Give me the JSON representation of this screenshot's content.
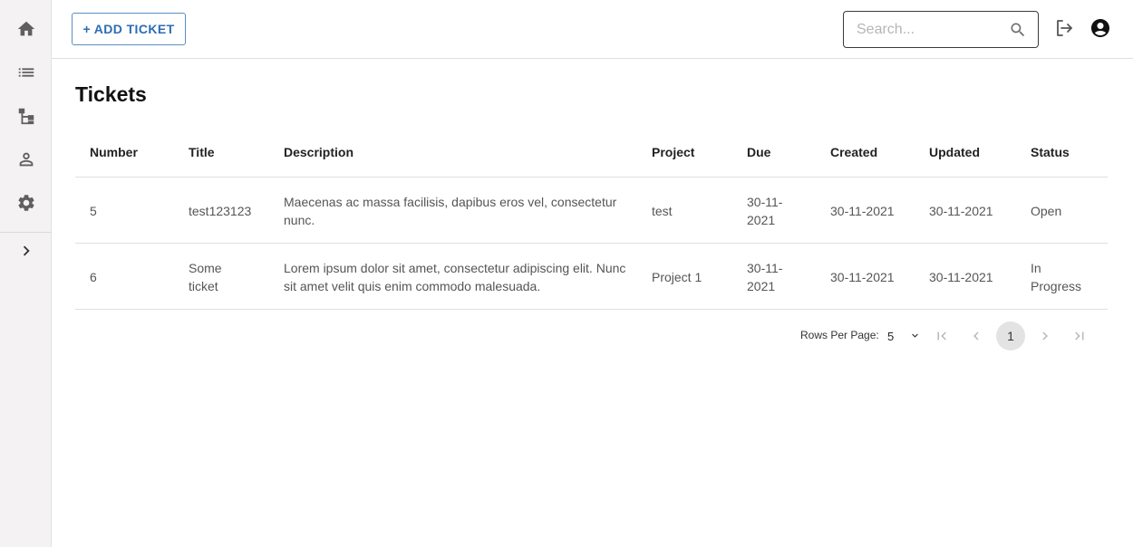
{
  "toolbar": {
    "add_ticket_label": "+ ADD TICKET",
    "search_placeholder": "Search..."
  },
  "page": {
    "title": "Tickets"
  },
  "table": {
    "columns": [
      "Number",
      "Title",
      "Description",
      "Project",
      "Due",
      "Created",
      "Updated",
      "Status"
    ],
    "rows": [
      {
        "number": "5",
        "title": "test123123",
        "description": "Maecenas ac massa facilisis, dapibus eros vel, consectetur nunc.",
        "project": "test",
        "due": "30-11-2021",
        "created": "30-11-2021",
        "updated": "30-11-2021",
        "status": "Open"
      },
      {
        "number": "6",
        "title": "Some ticket",
        "description": "Lorem ipsum dolor sit amet, consectetur adipiscing elit. Nunc sit amet velit quis enim commodo malesuada.",
        "project": "Project 1",
        "due": "30-11-2021",
        "created": "30-11-2021",
        "updated": "30-11-2021",
        "status": "In Progress"
      }
    ]
  },
  "pagination": {
    "rows_per_page_label": "Rows Per Page:",
    "rows_per_page_value": "5",
    "current_page": "1"
  },
  "icons": {
    "sidebar": [
      "home-icon",
      "list-icon",
      "hierarchy-icon",
      "person-icon",
      "gear-icon",
      "chevron-right-icon"
    ],
    "topbar": [
      "search-icon",
      "logout-icon",
      "account-circle-icon"
    ]
  },
  "colors": {
    "accent": "#2c6db3",
    "sidebar_bg": "#f4f2f3"
  }
}
